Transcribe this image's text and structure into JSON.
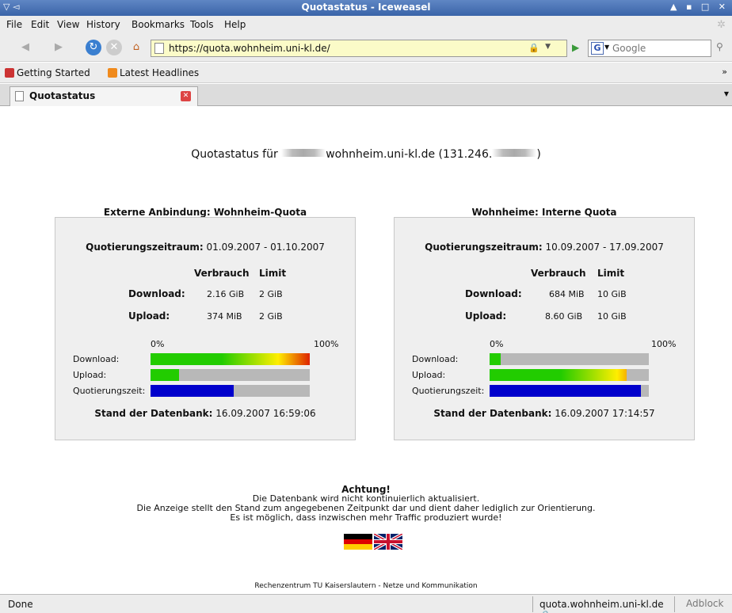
{
  "window": {
    "title": "Quotastatus - Iceweasel",
    "left_icons": "▽ ◅",
    "right_icons": "▲ ▪ □ ✕"
  },
  "menu": [
    "File",
    "Edit",
    "View",
    "History",
    "Bookmarks",
    "Tools",
    "Help"
  ],
  "nav": {
    "url": "https://quota.wohnheim.uni-kl.de/",
    "search_placeholder": "Google"
  },
  "bookmarks": [
    {
      "label": "Getting Started",
      "icon": "firefox-icon"
    },
    {
      "label": "Latest Headlines",
      "icon": "rss-icon"
    }
  ],
  "tab": {
    "label": "Quotastatus"
  },
  "page": {
    "heading_prefix": "Quotastatus für ",
    "heading_mid": "wohnheim.uni-kl.de (131.246.",
    "heading_suffix": ")",
    "panels": [
      {
        "title": "Externe Anbindung: Wohnheim-Quota",
        "period_label": "Quotierungszeitraum:",
        "period_value": " 01.09.2007 - 01.10.2007",
        "col_usage": "Verbrauch",
        "col_limit": "Limit",
        "download_label": "Download:",
        "download_usage": "2.16 GiB",
        "download_limit": "2 GiB",
        "upload_label": "Upload:",
        "upload_usage": "374 MiB",
        "upload_limit": "2 GiB",
        "pct_min": "0%",
        "pct_max": "100%",
        "bar_download_label": "Download:",
        "bar_upload_label": "Upload:",
        "bar_time_label": "Quotierungszeit:",
        "bar_download_fraction": 1.0,
        "bar_upload_fraction": 0.18,
        "bar_time_fraction": 0.52,
        "db_label": "Stand der Datenbank:",
        "db_value": " 16.09.2007 16:59:06"
      },
      {
        "title": "Wohnheime: Interne Quota",
        "period_label": "Quotierungszeitraum:",
        "period_value": " 10.09.2007 - 17.09.2007",
        "col_usage": "Verbrauch",
        "col_limit": "Limit",
        "download_label": "Download:",
        "download_usage": "684 MiB",
        "download_limit": "10 GiB",
        "upload_label": "Upload:",
        "upload_usage": "8.60 GiB",
        "upload_limit": "10 GiB",
        "pct_min": "0%",
        "pct_max": "100%",
        "bar_download_label": "Download:",
        "bar_upload_label": "Upload:",
        "bar_time_label": "Quotierungszeit:",
        "bar_download_fraction": 0.07,
        "bar_upload_fraction": 0.86,
        "bar_time_fraction": 0.95,
        "db_label": "Stand der Datenbank:",
        "db_value": " 16.09.2007 17:14:57"
      }
    ],
    "notice_title": "Achtung!",
    "notice_lines": [
      "Die Datenbank wird nicht kontinuierlich aktualisiert.",
      "Die Anzeige stellt den Stand zum angegebenen Zeitpunkt dar und dient daher lediglich zur Orientierung.",
      "Es ist möglich, dass inzwischen mehr Traffic produziert wurde!"
    ],
    "footer": "Rechenzentrum TU Kaiserslautern - Netze und Kommunikation"
  },
  "status": {
    "text": "Done",
    "host": "quota.wohnheim.uni-kl.de",
    "adblock": "Adblock"
  },
  "colors": {
    "bar_bg": "#b8b8b8",
    "time_bar": "#0000cc",
    "usage_green": "#22cc00",
    "usage_red": "#dd2200"
  }
}
